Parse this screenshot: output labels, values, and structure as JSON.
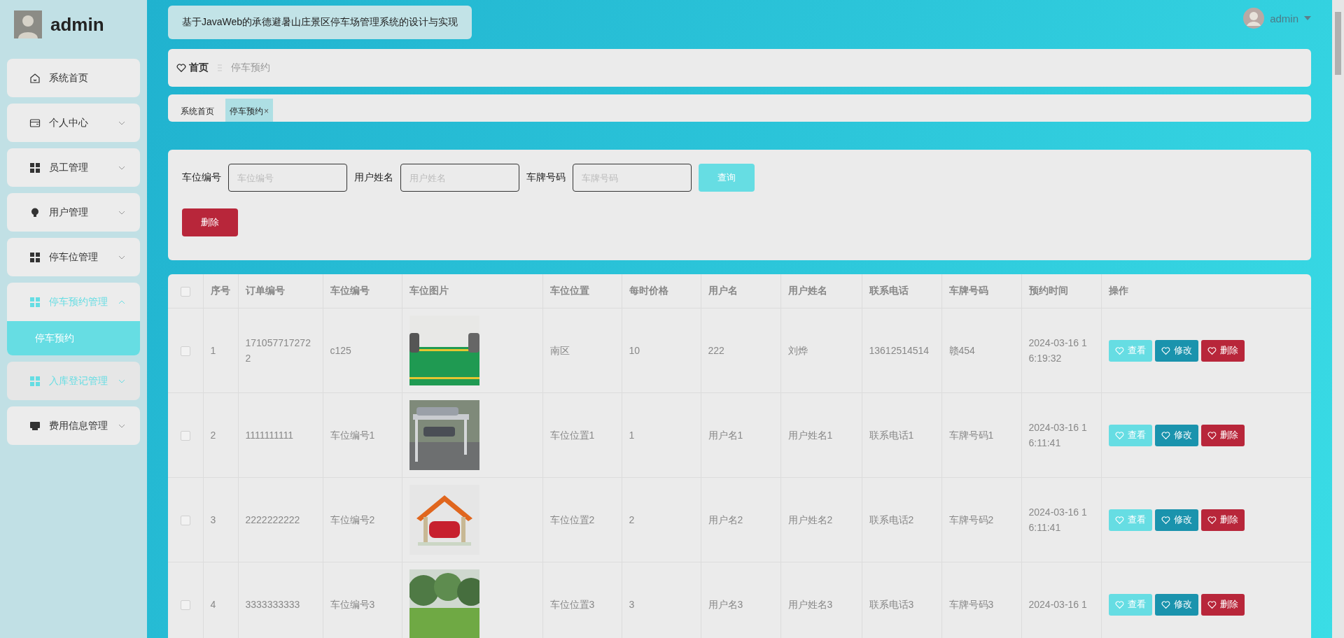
{
  "sidebar": {
    "user": "admin",
    "items": [
      {
        "label": "系统首页",
        "kind": "link",
        "hovered": false
      },
      {
        "label": "个人中心",
        "kind": "menu",
        "expanded": false,
        "hovered": false
      },
      {
        "label": "员工管理",
        "kind": "menu",
        "expanded": false,
        "hovered": false
      },
      {
        "label": "用户管理",
        "kind": "menu",
        "expanded": false,
        "hovered": false
      },
      {
        "label": "停车位管理",
        "kind": "menu",
        "expanded": false,
        "hovered": false
      },
      {
        "label": "停车预约管理",
        "kind": "menu",
        "expanded": true,
        "hovered": false,
        "children": [
          {
            "label": "停车预约",
            "selected": true
          }
        ]
      },
      {
        "label": "入库登记管理",
        "kind": "menu",
        "expanded": false,
        "hovered": true
      },
      {
        "label": "费用信息管理",
        "kind": "menu",
        "expanded": false,
        "hovered": false
      }
    ]
  },
  "header": {
    "title": "基于JavaWeb的承德避暑山庄景区停车场管理系统的设计与实现",
    "user": "admin"
  },
  "breadcrumb": {
    "home": "首页",
    "current": "停车预约"
  },
  "tabs": [
    {
      "label": "系统首页",
      "selected": false
    },
    {
      "label": "停车预约",
      "selected": true,
      "close": "×"
    }
  ],
  "search": {
    "fields": [
      {
        "label": "车位编号",
        "placeholder": "车位编号"
      },
      {
        "label": "用户姓名",
        "placeholder": "用户姓名"
      },
      {
        "label": "车牌号码",
        "placeholder": "车牌号码"
      }
    ],
    "query_button": "查询",
    "delete_button": "删除"
  },
  "table": {
    "header_checked": false,
    "columns": [
      "序号",
      "订单编号",
      "车位编号",
      "车位图片",
      "车位位置",
      "每时价格",
      "用户名",
      "用户姓名",
      "联系电话",
      "车牌号码",
      "预约时间",
      "操作"
    ],
    "rows": [
      {
        "checked": false,
        "index": "1",
        "order_no": "1710577172722",
        "spot_no": "c125",
        "picture": {
          "kind": "picture"
        },
        "location": "南区",
        "price": "10",
        "username": "222",
        "name": "刘烨",
        "phone": "13612514514",
        "plate": "赣454",
        "time": "2024-03-16 16:19:32",
        "actions": [
          {
            "label": "查看",
            "kind": "view"
          },
          {
            "label": "修改",
            "kind": "edit"
          },
          {
            "label": "删除",
            "kind": "delete"
          }
        ]
      },
      {
        "checked": false,
        "index": "2",
        "order_no": "1111111111",
        "spot_no": "车位编号1",
        "picture": {
          "kind": "picture"
        },
        "location": "车位位置1",
        "price": "1",
        "username": "用户名1",
        "name": "用户姓名1",
        "phone": "联系电话1",
        "plate": "车牌号码1",
        "time": "2024-03-16 16:11:41",
        "actions": [
          {
            "label": "查看",
            "kind": "view"
          },
          {
            "label": "修改",
            "kind": "edit"
          },
          {
            "label": "删除",
            "kind": "delete"
          }
        ]
      },
      {
        "checked": false,
        "index": "3",
        "order_no": "2222222222",
        "spot_no": "车位编号2",
        "picture": {
          "kind": "picture"
        },
        "location": "车位位置2",
        "price": "2",
        "username": "用户名2",
        "name": "用户姓名2",
        "phone": "联系电话2",
        "plate": "车牌号码2",
        "time": "2024-03-16 16:11:41",
        "actions": [
          {
            "label": "查看",
            "kind": "view"
          },
          {
            "label": "修改",
            "kind": "edit"
          },
          {
            "label": "删除",
            "kind": "delete"
          }
        ]
      },
      {
        "checked": false,
        "index": "4",
        "order_no": "3333333333",
        "spot_no": "车位编号3",
        "picture": {
          "kind": "picture"
        },
        "location": "车位位置3",
        "price": "3",
        "username": "用户名3",
        "name": "用户姓名3",
        "phone": "联系电话3",
        "plate": "车牌号码3",
        "time": "2024-03-16 1",
        "actions": [
          {
            "label": "查看",
            "kind": "view"
          },
          {
            "label": "修改",
            "kind": "edit"
          },
          {
            "label": "删除",
            "kind": "delete"
          }
        ]
      }
    ]
  }
}
